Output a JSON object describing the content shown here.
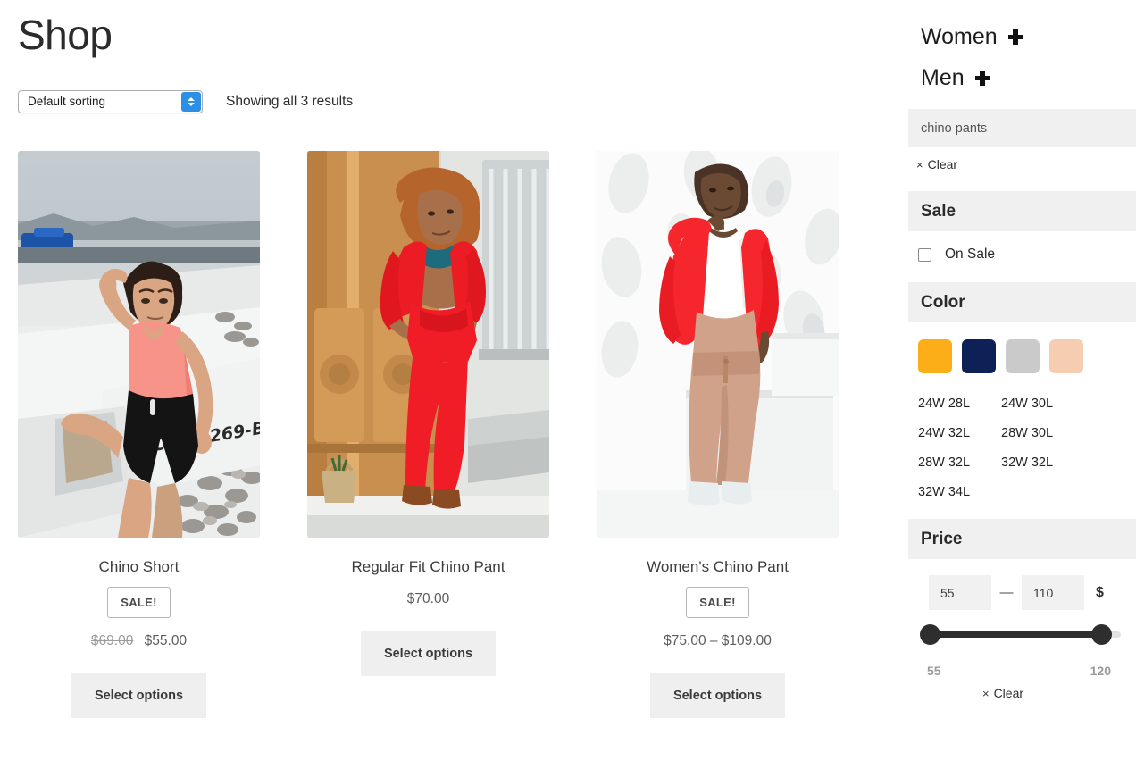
{
  "header": {
    "title": "Shop",
    "sort_value": "Default sorting",
    "result_count": "Showing all 3 results"
  },
  "products": [
    {
      "title": "Chino Short",
      "on_sale": true,
      "sale_label": "SALE!",
      "price_old": "$69.00",
      "price_new": "$55.00",
      "button": "Select options",
      "image_alt": "man-in-pink-tank-top-on-boat"
    },
    {
      "title": "Regular Fit Chino Pant",
      "on_sale": false,
      "sale_label": "",
      "price_old": "",
      "price_new": "$70.00",
      "button": "Select options",
      "image_alt": "woman-in-red-suit-by-wooden-door"
    },
    {
      "title": "Women's Chino Pant",
      "on_sale": true,
      "sale_label": "SALE!",
      "price_old": "",
      "price_new": "$75.00 – $109.00",
      "button": "Select options",
      "image_alt": "woman-in-red-cardigan-and-tan-pants"
    }
  ],
  "sidebar": {
    "categories": [
      {
        "label": "Women",
        "icon": "plus-icon"
      },
      {
        "label": "Men",
        "icon": "plus-icon"
      }
    ],
    "search_tag": "chino pants",
    "tag_clear": "Clear",
    "tag_clear_mark": "×",
    "sale": {
      "heading": "Sale",
      "option_label": "On Sale",
      "checked": false
    },
    "color": {
      "heading": "Color",
      "swatches": [
        {
          "name": "amber",
          "hex": "#FBAE17"
        },
        {
          "name": "navy",
          "hex": "#0E2156"
        },
        {
          "name": "light-gray",
          "hex": "#CACACA"
        },
        {
          "name": "peach",
          "hex": "#F6CDB0"
        }
      ]
    },
    "sizes": [
      "24W 28L",
      "24W 30L",
      "24W 32L",
      "28W 30L",
      "28W 32L",
      "32W 32L",
      "32W 34L"
    ],
    "price": {
      "heading": "Price",
      "min_value": "55",
      "max_value": "110",
      "separator": "—",
      "currency": "$",
      "range_min_label": "55",
      "range_max_label": "120",
      "clear_label": "Clear",
      "clear_mark": "×"
    }
  }
}
